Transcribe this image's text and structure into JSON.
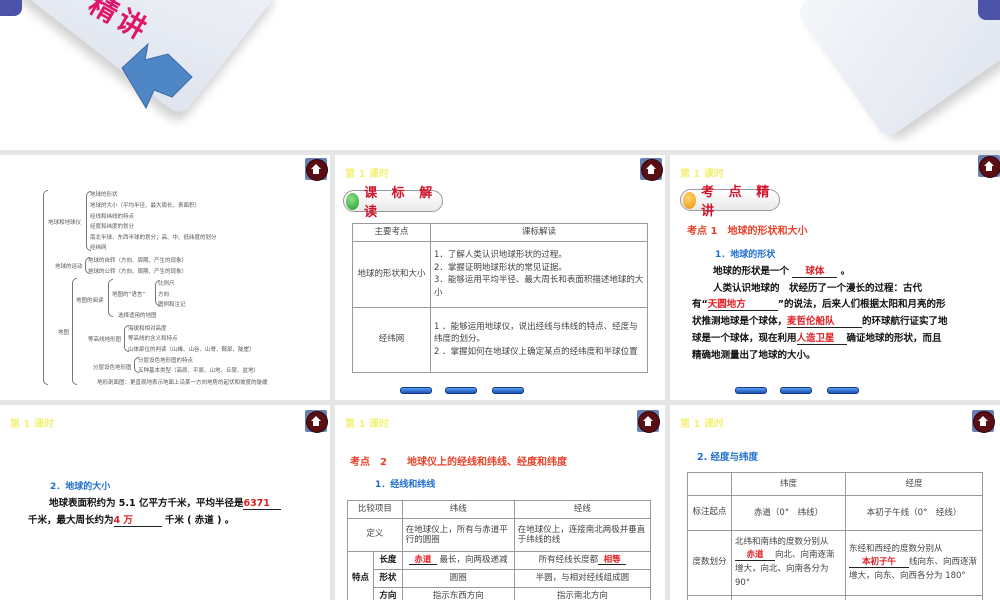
{
  "top": {
    "title_fragment": "精讲"
  },
  "lesson": "第 1 课时",
  "mindmap": {
    "root_groups": [
      "地球和地球仪",
      "地球的运动",
      "地图"
    ],
    "globe_items": [
      "地球的形状",
      "地球的大小（平均半径、最大周长、表面积）",
      "经线和纬线的特点",
      "经度和纬度的划分",
      "南北半球、东西半球的划分；高、中、低纬度的划分",
      "经纬网"
    ],
    "motion_items": [
      "地球的自转（方向、周期、产生的现象）",
      "地球的公转（方向、周期、产生的现象）"
    ],
    "map_reading": "地图的阅读",
    "map_language": "地图的“语言”",
    "language_items": [
      "比例尺",
      "方向",
      "图例和注记"
    ],
    "choose_map": "选择适用的地图",
    "contour": "等高线地形图",
    "contour_items": [
      "海拔和相对高度",
      "等高线的含义和特点",
      "山体部位的判读（山峰、山谷、山脊、鞍部、陡崖）"
    ],
    "layered": "分层设色地形图",
    "layered_items": [
      "分层设色地形图的特点",
      "五种基本类型（高原、平原、山地、丘陵、盆地）"
    ],
    "profile": "地形剖面图：更直观地表示地面上沿某一方向地势的起伏和坡度的陡缓"
  },
  "standards": {
    "badge": "课 标 解 读",
    "headers": [
      "主要考点",
      "课标解读"
    ],
    "rows": [
      {
        "topic": "地球的形状和大小",
        "items": [
          "1．了解人类认识地球形状的过程。",
          "2．掌握证明地球形状的常见证据。",
          "3．能够运用平均半径、最大周长和表面积描述地球的大小"
        ]
      },
      {
        "topic": "经纬网",
        "items": [
          "1 ．能够运用地球仪，说出经线与纬线的特点、经度与纬度的划分。",
          "2 ．掌握如何在地球仪上确定某点的经纬度和半球位置"
        ]
      }
    ]
  },
  "point1": {
    "badge": "考 点 精 讲",
    "heading": "考点 1　地球的形状和大小",
    "sub": "1．地球的形状",
    "l1a": "地球的形状是一个",
    "a1": "球体",
    "l1b": "。",
    "l2": "人类认识地球的　状经历了一个漫长的过程：古代",
    "l3a": "有“",
    "a2": "天圆地方",
    "l3b": "”的说法，后来人们根据太阳和月亮的形",
    "l4a": "状推测地球是个球体，",
    "a3": "麦哲伦船队",
    "l4b": "的环球航行证实了地",
    "l5a": "球是一个球体，现在利用",
    "a4": "人造卫星",
    "l5b": "确证地球的形状，而且",
    "l6": "精确地测量出了地球的大小。"
  },
  "size": {
    "sub": "2．地球的大小",
    "l1a": "地球表面积约为 5.1 亿平方千米，平均半径是",
    "a1": "6371",
    "l2a": "千米，最大周长约为",
    "a2": "4 万",
    "l2b": "千米 ( 赤道 ) 。"
  },
  "point2": {
    "heading": "考点　2　　地球仪上的经线和纬线、经度和纬度",
    "sub": "1．经线和纬线",
    "headers": [
      "比较项目",
      "纬线",
      "经线"
    ],
    "def": {
      "label": "定义",
      "lat": "在地球仪上，所有与赤道平行的圆圈",
      "lon": "在地球仪上，连接南北两极并垂直于纬线的线"
    },
    "feature": "特点",
    "length": {
      "label": "长度",
      "lat_ans": "赤道",
      "lat": "最长，向两极递减",
      "lon": "所有经线长度都",
      "lon_ans": "相等"
    },
    "shape": {
      "label": "形状",
      "lat": "圆圈",
      "lon": "半圆，与相对经线组成圆"
    },
    "direction": {
      "label": "方向",
      "lat": "指示东西方向",
      "lon": "指示南北方向"
    }
  },
  "degrees": {
    "sub": "2. 经度与纬度",
    "headers": [
      "",
      "纬度",
      "经度"
    ],
    "origin": {
      "label": "标注起点",
      "lat": "赤道（0°　纬线）",
      "lon": "本初子午线（0°　经线）"
    },
    "division": {
      "label": "度数划分",
      "lat_a": "北纬和南纬的度数分别从",
      "lat_ans": "赤道",
      "lat_b": "向北、向南逐渐增大，向北、向南各分为 90°",
      "lon_a": "东经和西经的度数分别从",
      "lon_ans": "本初子午",
      "lon_b": "线向东、向西逐渐增大，向东、向西各分为 180°"
    }
  }
}
